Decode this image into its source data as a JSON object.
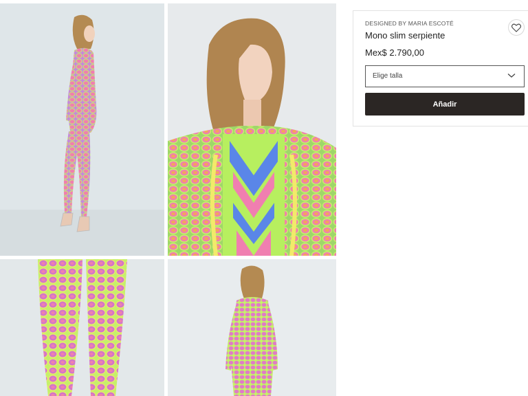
{
  "gallery": {
    "photos": [
      {
        "label": "model-side-view"
      },
      {
        "label": "model-closeup"
      },
      {
        "label": "legs-detail"
      },
      {
        "label": "model-back-view"
      }
    ]
  },
  "product": {
    "designer": "DESIGNED BY MARIA ESCOTÉ",
    "name": "Mono slim serpiente",
    "price": "Mex$ 2.790,00",
    "size_select_label": "Elige talla",
    "add_button_label": "Añadir",
    "favorite_icon": "heart-icon",
    "dropdown_icon": "chevron-down-icon"
  },
  "colors": {
    "button_bg": "#2b2624",
    "pink": "#f07fb0",
    "lime": "#c6f06a",
    "blue": "#5a86e8",
    "yellow": "#f2ea6a"
  }
}
